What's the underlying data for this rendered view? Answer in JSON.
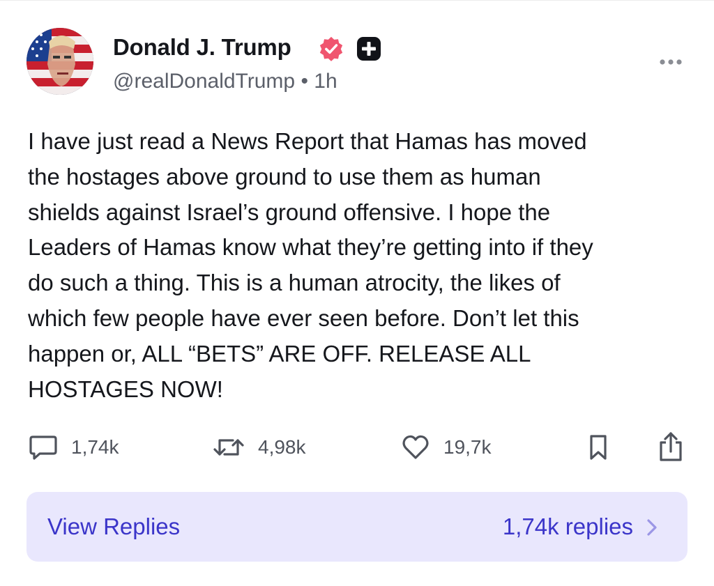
{
  "post": {
    "author": {
      "display_name": "Donald J. Trump",
      "handle_line": "@realDonaldTrump • 1h"
    },
    "body": "I have just read a News Report that Hamas has moved\nthe hostages above ground to use them as human\nshields against Israel’s ground offensive. I hope the\nLeaders of Hamas know what they’re getting into if they\ndo such a thing. This is a human atrocity, the likes of\nwhich few people have ever seen before. Don’t let this\nhappen or, ALL “BETS” ARE OFF. RELEASE ALL\nHOSTAGES NOW!",
    "actions": {
      "replies": "1,74k",
      "reposts": "4,98k",
      "likes": "19,7k"
    }
  },
  "view_replies": {
    "label": "View Replies",
    "count_text": "1,74k replies"
  },
  "icons": [
    "verified-badge-icon",
    "plus-badge-icon",
    "more-icon",
    "comment-icon",
    "repost-icon",
    "heart-icon",
    "bookmark-icon",
    "share-icon",
    "chevron-right-icon"
  ],
  "colors": {
    "verified_badge": "#f0556f",
    "accent": "#3b35c9",
    "replies_bg": "#e9e7fd",
    "text": "#15171c",
    "muted": "#5b5f69"
  }
}
